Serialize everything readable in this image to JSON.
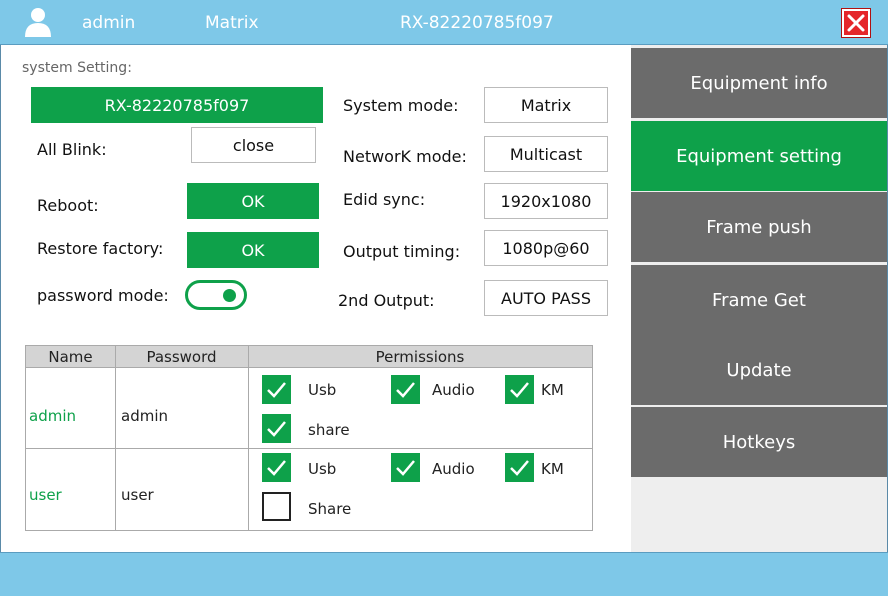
{
  "header": {
    "username": "admin",
    "mode": "Matrix",
    "device_id": "RX-82220785f097"
  },
  "system": {
    "section_title": "system Setting:",
    "device_name": "RX-82220785f097",
    "all_blink_label": "All Blink:",
    "all_blink_value": "close",
    "reboot_label": "Reboot:",
    "reboot_button": "OK",
    "restore_label": "Restore factory:",
    "restore_button": "OK",
    "password_mode_label": "password mode:",
    "password_mode_on": true,
    "system_mode_label": "System mode:",
    "system_mode_value": "Matrix",
    "network_mode_label": "NetworK mode:",
    "network_mode_value": "Multicast",
    "edid_sync_label": "Edid sync:",
    "edid_sync_value": "1920x1080",
    "output_timing_label": "Output timing:",
    "output_timing_value": "1080p@60",
    "second_output_label": "2nd Output:",
    "second_output_value": "AUTO PASS"
  },
  "table": {
    "headers": [
      "Name",
      "Password",
      "Permissions"
    ],
    "rows": [
      {
        "name": "admin",
        "password": "admin",
        "usb_label": "Usb",
        "usb": true,
        "audio_label": "Audio",
        "audio": true,
        "km_label": "KM",
        "km": true,
        "share_label": "share",
        "share": true
      },
      {
        "name": "user",
        "password": "user",
        "usb_label": "Usb",
        "usb": true,
        "audio_label": "Audio",
        "audio": true,
        "km_label": "KM",
        "km": true,
        "share_label": "Share",
        "share": false
      }
    ]
  },
  "sidebar": {
    "items": [
      {
        "label": "Equipment info",
        "active": false
      },
      {
        "label": "Equipment setting",
        "active": true
      },
      {
        "label": "Frame push",
        "active": false
      },
      {
        "label": "Frame Get",
        "active": false
      },
      {
        "label": "Update",
        "active": false
      },
      {
        "label": "Hotkeys",
        "active": false
      }
    ]
  },
  "colors": {
    "header_bg": "#7ec8e8",
    "accent_green": "#0ea14a",
    "sidebar_gray": "#6b6b6b",
    "close_red": "#e5262a"
  },
  "icons": {
    "user": "user-icon",
    "close": "close-icon",
    "checked": "checkbox-checked-icon",
    "unchecked": "checkbox-unchecked-icon"
  }
}
